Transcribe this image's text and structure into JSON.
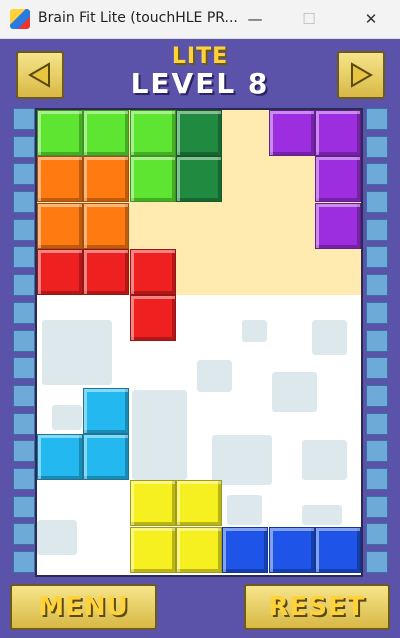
{
  "window": {
    "title": "Brain Fit Lite (touchHLE PR...",
    "min": "—",
    "max": "☐",
    "close": "✕"
  },
  "header": {
    "lite": "LITE",
    "level": "LEVEL 8"
  },
  "buttons": {
    "menu": "MENU",
    "reset": "RESET"
  },
  "icons": {
    "app": "app-icon",
    "prev": "left-triangle-icon",
    "next": "right-triangle-icon"
  },
  "colors": {
    "background": "#5b52aa",
    "accent": "#ffd23a",
    "green": "#5ee532",
    "dark_green": "#1f8a40",
    "purple": "#9c2ee0",
    "orange": "#ff7a10",
    "red": "#ee2020",
    "cyan": "#24b8f0",
    "yellow": "#f6f020",
    "blue": "#1e55e8"
  },
  "pieces": [
    {
      "name": "green-piece",
      "color": "green",
      "cells": [
        [
          0,
          0
        ],
        [
          1,
          0
        ],
        [
          2,
          0
        ],
        [
          2,
          1
        ]
      ]
    },
    {
      "name": "dark-green-piece",
      "color": "dark_green",
      "cells": [
        [
          3,
          0
        ],
        [
          3,
          1
        ]
      ]
    },
    {
      "name": "purple-piece",
      "color": "purple",
      "cells": [
        [
          5,
          0
        ],
        [
          6,
          0
        ],
        [
          6,
          1
        ],
        [
          6,
          2
        ]
      ]
    },
    {
      "name": "orange-piece",
      "color": "orange",
      "cells": [
        [
          0,
          1
        ],
        [
          1,
          1
        ],
        [
          0,
          2
        ],
        [
          1,
          2
        ]
      ]
    },
    {
      "name": "red-piece",
      "color": "red",
      "cells": [
        [
          0,
          3
        ],
        [
          1,
          3
        ],
        [
          2,
          3
        ],
        [
          2,
          4
        ]
      ]
    },
    {
      "name": "cyan-piece",
      "color": "cyan",
      "cells": [
        [
          1,
          6
        ],
        [
          0,
          7
        ],
        [
          1,
          7
        ]
      ]
    },
    {
      "name": "yellow-piece",
      "color": "yellow",
      "cells": [
        [
          2,
          8
        ],
        [
          3,
          8
        ],
        [
          2,
          9
        ],
        [
          3,
          9
        ]
      ]
    },
    {
      "name": "blue-piece",
      "color": "blue",
      "cells": [
        [
          4,
          9
        ],
        [
          5,
          9
        ],
        [
          6,
          9
        ]
      ]
    }
  ]
}
